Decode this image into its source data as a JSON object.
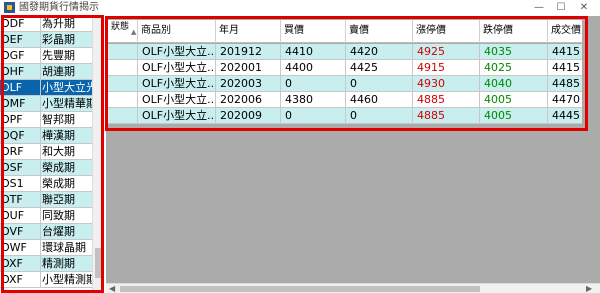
{
  "window": {
    "title": "國發期貨行情揭示",
    "min_icon": "minimize-icon",
    "max_icon": "maximize-icon",
    "close_icon": "close-icon",
    "min_glyph": "—",
    "max_glyph": "☐",
    "close_glyph": "✕"
  },
  "left_list": {
    "items": [
      {
        "code": "ODF",
        "name": "為升期"
      },
      {
        "code": "OEF",
        "name": "彩晶期"
      },
      {
        "code": "OGF",
        "name": "先豐期"
      },
      {
        "code": "OHF",
        "name": "胡連期"
      },
      {
        "code": "OLF",
        "name": "小型大立光"
      },
      {
        "code": "OMF",
        "name": "小型精華期"
      },
      {
        "code": "OPF",
        "name": "智邦期"
      },
      {
        "code": "OQF",
        "name": "樺漢期"
      },
      {
        "code": "ORF",
        "name": "和大期"
      },
      {
        "code": "OSF",
        "name": "榮成期"
      },
      {
        "code": "OS1",
        "name": "榮成期"
      },
      {
        "code": "OTF",
        "name": "聯亞期"
      },
      {
        "code": "OUF",
        "name": "同致期"
      },
      {
        "code": "OVF",
        "name": "台燿期"
      },
      {
        "code": "OWF",
        "name": "環球晶期"
      },
      {
        "code": "OXF",
        "name": "精測期"
      },
      {
        "code": "OXF",
        "name": "小型精測期"
      }
    ],
    "selected_index": 4
  },
  "grid": {
    "columns": [
      "狀態",
      "商品別",
      "年月",
      "買價",
      "賣價",
      "漲停價",
      "跌停價",
      "成交價"
    ],
    "rows": [
      {
        "product": "OLF小型大立...",
        "month": "201912",
        "bid": "4410",
        "ask": "4420",
        "limit_up": "4925",
        "limit_down": "4035",
        "last": "4415"
      },
      {
        "product": "OLF小型大立...",
        "month": "202001",
        "bid": "4400",
        "ask": "4425",
        "limit_up": "4915",
        "limit_down": "4025",
        "last": "4415"
      },
      {
        "product": "OLF小型大立...",
        "month": "202003",
        "bid": "0",
        "ask": "0",
        "limit_up": "4930",
        "limit_down": "4040",
        "last": "4485"
      },
      {
        "product": "OLF小型大立...",
        "month": "202006",
        "bid": "4380",
        "ask": "4460",
        "limit_up": "4885",
        "limit_down": "4005",
        "last": "4470"
      },
      {
        "product": "OLF小型大立...",
        "month": "202009",
        "bid": "0",
        "ask": "0",
        "limit_up": "4885",
        "limit_down": "4005",
        "last": "4445"
      }
    ],
    "sort_icon": "sort-arrow-icon",
    "sort_glyph": "▲"
  },
  "scrollbar": {
    "left_arrow_glyph": "◀",
    "right_arrow_glyph": "▶"
  },
  "colors": {
    "limit_up": "#d40000",
    "limit_down": "#008a00",
    "selected_row": "#0a64ad",
    "alt_row": "#c8eef0",
    "highlight_outline": "#e00000"
  }
}
